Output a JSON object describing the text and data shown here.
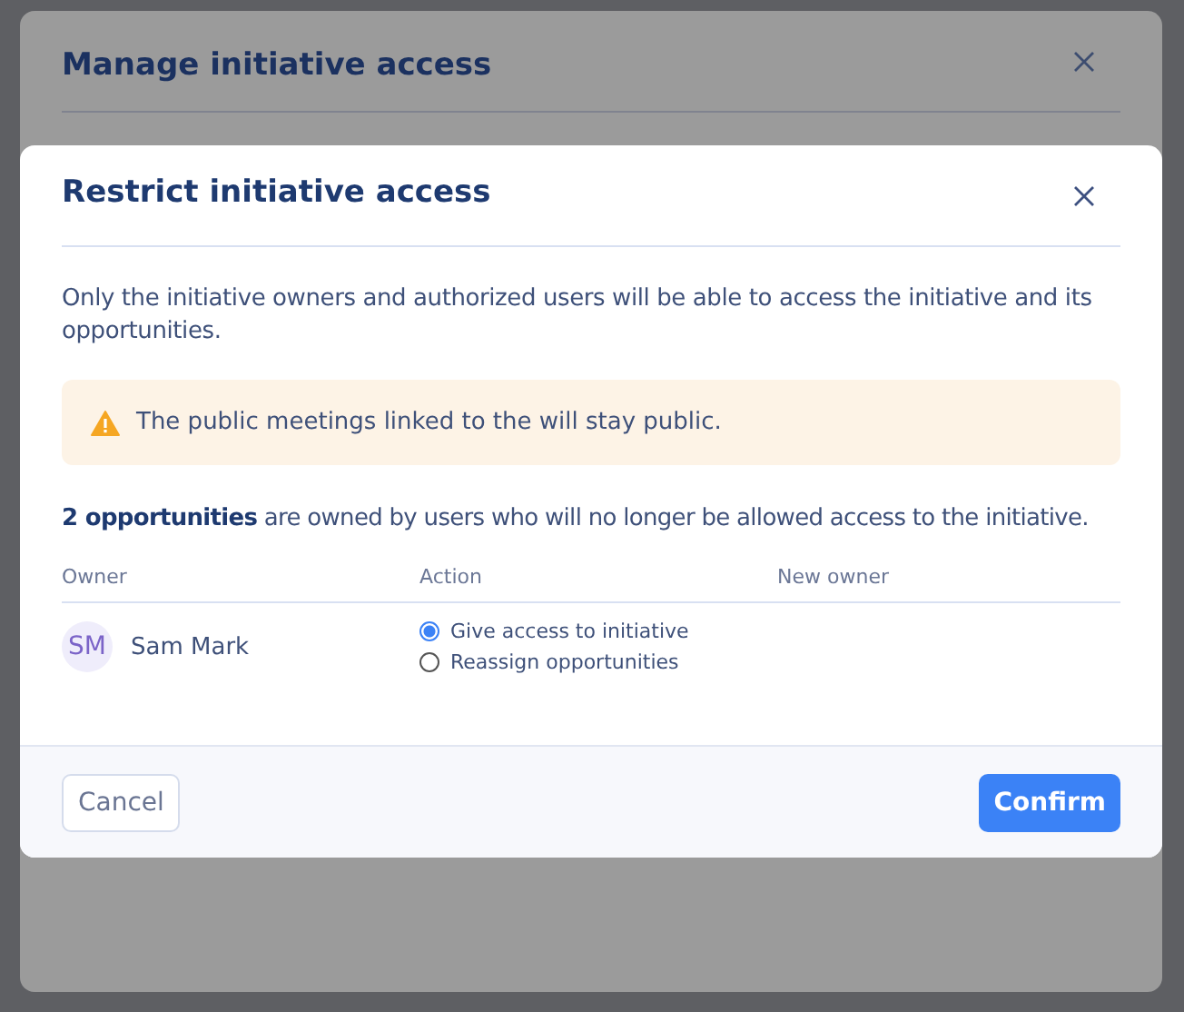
{
  "outer_dialog": {
    "title": "Manage initiative access"
  },
  "dialog": {
    "title": "Restrict initiative access",
    "description": "Only the initiative owners and authorized users will be able to access the initiative and its opportunities.",
    "warning": "The public meetings linked to the will stay public.",
    "summary": "**2 opportunities** are owned by users who will no longer be allowed access to the initiative.",
    "columns": [
      "Owner",
      "Action",
      "New owner"
    ],
    "rows": [
      {
        "initials": "SM",
        "owner": "Sam Mark",
        "options": [
          {
            "label": "Give access to initiative",
            "selected": true
          },
          {
            "label": "Reassign opportunities",
            "selected": false
          }
        ]
      }
    ],
    "buttons": {
      "cancel": "Cancel",
      "confirm": "Confirm"
    }
  }
}
